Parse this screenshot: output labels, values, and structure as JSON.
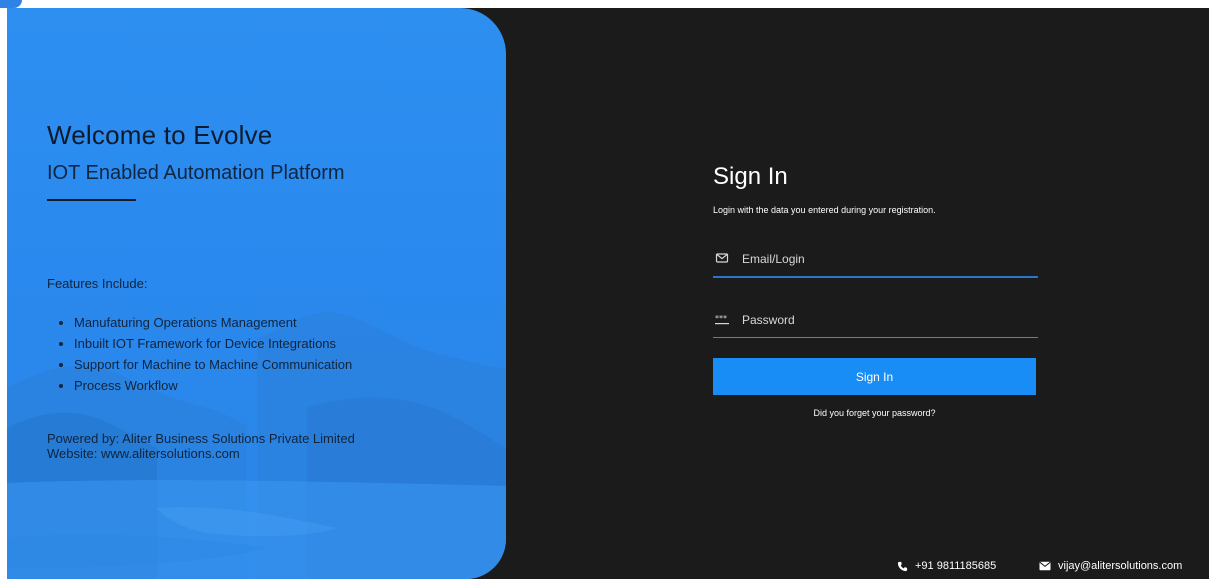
{
  "hero": {
    "title": "Welcome to Evolve",
    "subtitle": "IOT Enabled Automation Platform",
    "features_heading": "Features Include:",
    "features": [
      "Manufaturing Operations Management",
      "Inbuilt IOT Framework for Device Integrations",
      "Support for Machine to Machine Communication",
      "Process Workflow"
    ],
    "powered_by": "Powered by: Aliter Business Solutions Private Limited",
    "website": "Website: www.alitersolutions.com"
  },
  "signin": {
    "title": "Sign In",
    "subtitle": "Login with the data you entered during your registration.",
    "email_placeholder": "Email/Login",
    "password_placeholder": "Password",
    "button_label": "Sign In",
    "forgot_link": "Did you forget your password?"
  },
  "footer": {
    "phone": "+91 9811185685",
    "email": "vijay@alitersolutions.com"
  },
  "icons": {
    "email_field": "envelope-icon",
    "password_field": "password-dots-icon",
    "phone": "phone-icon",
    "mail": "mail-icon"
  },
  "colors": {
    "hero_blue": "#2b8bf0",
    "background_dark": "#1b1b1c",
    "button_blue": "#178df5",
    "email_underline_active": "#2a74c9"
  }
}
